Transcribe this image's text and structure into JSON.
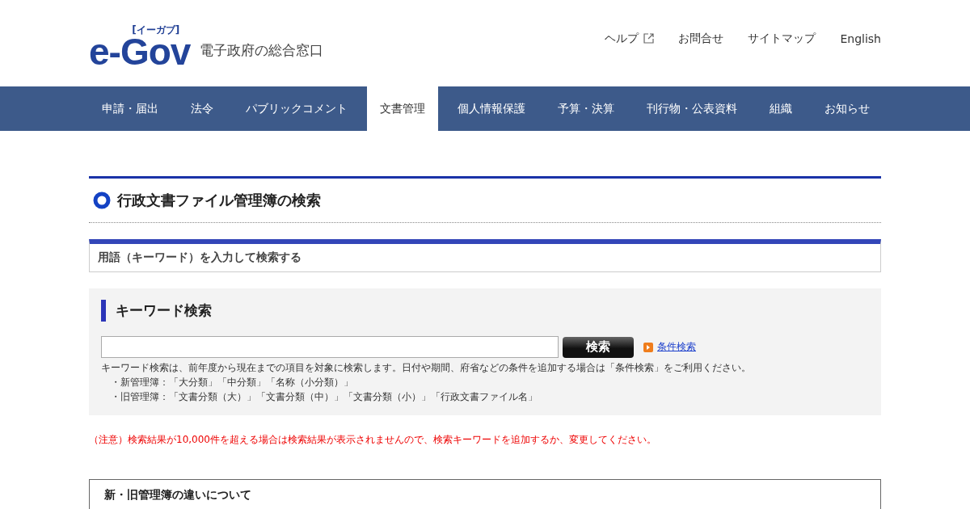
{
  "logo": {
    "wordmark": "e-Gov",
    "reading": "[イーガブ]",
    "tagline": "電子政府の総合窓口"
  },
  "header_links": [
    {
      "label": "ヘルプ",
      "external": true
    },
    {
      "label": "お問合せ",
      "external": false
    },
    {
      "label": "サイトマップ",
      "external": false
    },
    {
      "label": "English",
      "external": false
    }
  ],
  "nav": [
    {
      "label": "申請・届出",
      "selected": false
    },
    {
      "label": "法令",
      "selected": false
    },
    {
      "label": "パブリックコメント",
      "selected": false
    },
    {
      "label": "文書管理",
      "selected": true
    },
    {
      "label": "個人情報保護",
      "selected": false
    },
    {
      "label": "予算・決算",
      "selected": false
    },
    {
      "label": "刊行物・公表資料",
      "selected": false
    },
    {
      "label": "組織",
      "selected": false
    },
    {
      "label": "お知らせ",
      "selected": false
    }
  ],
  "page_title": "行政文書ファイル管理簿の検索",
  "section_tab": "用語（キーワード）を入力して検索する",
  "keyword_search": {
    "heading": "キーワード検索",
    "search_button": "検索",
    "advanced_link": "条件検索",
    "help": "キーワード検索は、前年度から現在までの項目を対象に検索します。日付や期間、府省などの条件を追加する場合は「条件検索」をご利用ください。",
    "bullets": [
      "・新管理簿：「大分類」「中分類」「名称（小分類）」",
      "・旧管理簿：「文書分類（大）」「文書分類（中）」「文書分類（小）」「行政文書ファイル名」"
    ]
  },
  "notice": "（注意）検索結果が10,000件を超える場合は検索結果が表示されませんので、検索キーワードを追加するか、変更してください。",
  "info_box_title": "新・旧管理簿の違いについて"
}
